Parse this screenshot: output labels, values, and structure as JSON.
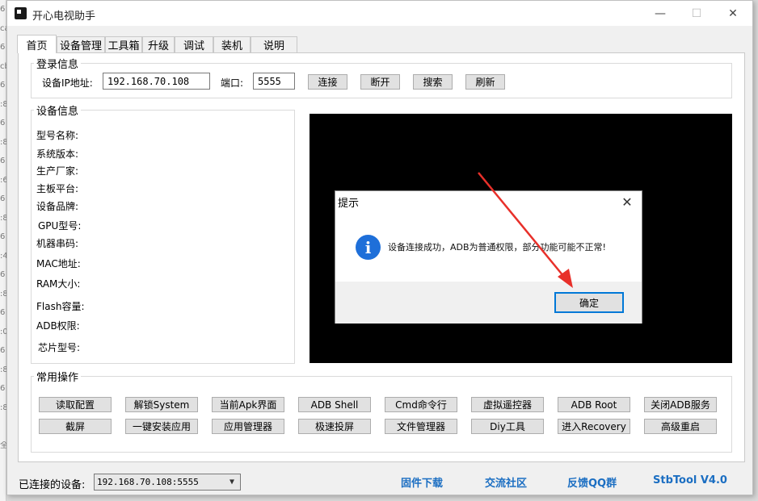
{
  "left_strip": {
    "chars": [
      "6",
      "ca",
      "6",
      "cb",
      "6",
      ":8",
      "6",
      ":8",
      "6",
      ":6",
      "6",
      ":8",
      "6",
      ":4",
      "6",
      ":8",
      "6",
      ":0",
      "6",
      ":8",
      "6",
      ":8",
      "",
      "全"
    ]
  },
  "window": {
    "title": "开心电视助手",
    "controls": {
      "minimize": "—",
      "maximize": "☐",
      "close": "✕"
    }
  },
  "tabs": [
    {
      "label": "首页",
      "active": true
    },
    {
      "label": "设备管理"
    },
    {
      "label": "工具箱"
    },
    {
      "label": "升级"
    },
    {
      "label": "调试"
    },
    {
      "label": "装机"
    },
    {
      "label": "说明"
    }
  ],
  "login": {
    "group_title": "登录信息",
    "ip_label": "设备IP地址:",
    "ip_value": "192.168.70.108",
    "port_label": "端口:",
    "port_value": "5555",
    "buttons": {
      "connect": "连接",
      "disconnect": "断开",
      "search": "搜索",
      "refresh": "刷新"
    }
  },
  "device_info": {
    "group_title": "设备信息",
    "fields": [
      "型号名称:",
      "系统版本:",
      "生产厂家:",
      "主板平台:",
      "设备品牌:",
      "GPU型号:",
      "机器串码:",
      "MAC地址:",
      "RAM大小:",
      "Flash容量:",
      "ADB权限:",
      "芯片型号:"
    ]
  },
  "common_ops": {
    "group_title": "常用操作",
    "row1": [
      "读取配置",
      "解锁System",
      "当前Apk界面",
      "ADB Shell",
      "Cmd命令行",
      "虚拟遥控器",
      "ADB  Root",
      "关闭ADB服务"
    ],
    "row2": [
      "截屏",
      "一键安装应用",
      "应用管理器",
      "极速投屏",
      "文件管理器",
      "Diy工具",
      "进入Recovery",
      "高级重启"
    ]
  },
  "dialog": {
    "title": "提示",
    "close": "✕",
    "icon": "info-icon",
    "message": "设备连接成功，ADB为普通权限，部分功能可能不正常!",
    "ok": "确定"
  },
  "bottom": {
    "connected_label": "已连接的设备:",
    "connected_value": "192.168.70.108:5555",
    "links": [
      "固件下载",
      "交流社区",
      "反馈QQ群",
      "StbTool V4.0"
    ]
  },
  "colors": {
    "link": "#1b6ec2",
    "accent": "#0078d7",
    "info_icon": "#1e6fd9",
    "annotation_arrow": "#e8302a",
    "preview_bg": "#000000"
  }
}
